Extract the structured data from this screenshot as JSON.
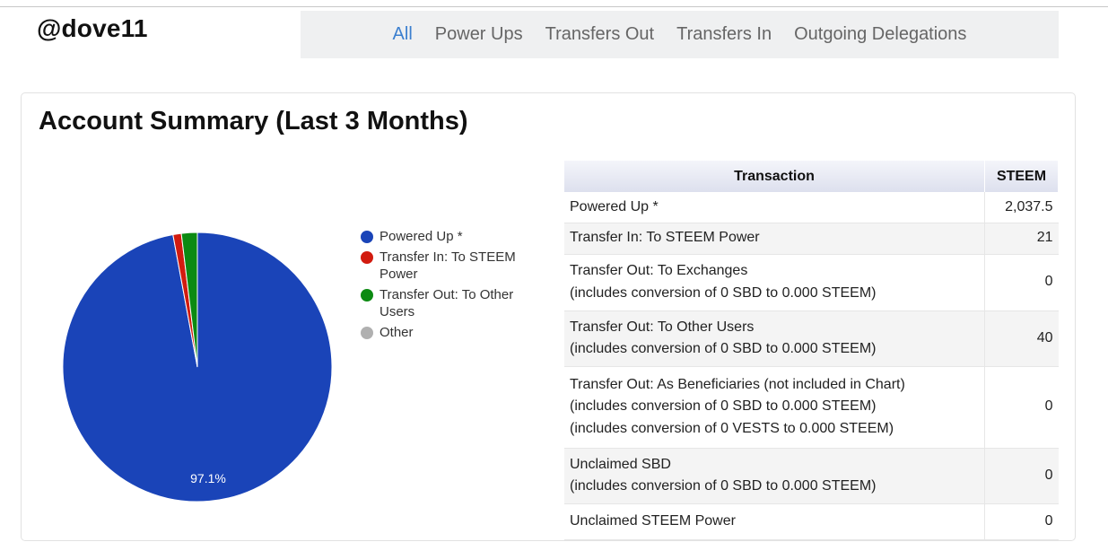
{
  "username": "@dove11",
  "nav": {
    "tabs": [
      {
        "label": "All",
        "active": true
      },
      {
        "label": "Power Ups",
        "active": false
      },
      {
        "label": "Transfers Out",
        "active": false
      },
      {
        "label": "Transfers In",
        "active": false
      },
      {
        "label": "Outgoing Delegations",
        "active": false
      }
    ]
  },
  "summary": {
    "title": "Account Summary (Last 3 Months)"
  },
  "chart_data": {
    "type": "pie",
    "title": "",
    "legend_position": "right",
    "slices": [
      {
        "label": "Powered Up *",
        "value": 2037.5,
        "color": "#1a44b8"
      },
      {
        "label": "Transfer In: To STEEM Power",
        "value": 21,
        "color": "#d21b0f"
      },
      {
        "label": "Transfer Out: To Other Users",
        "value": 40,
        "color": "#0c8a12"
      },
      {
        "label": "Other",
        "value": 0,
        "color": "#b0b0b0"
      }
    ],
    "slice_labels": [
      "97.1%"
    ]
  },
  "table": {
    "headers": [
      "Transaction",
      "STEEM"
    ],
    "rows": [
      {
        "lines": [
          "Powered Up *"
        ],
        "value": "2,037.5"
      },
      {
        "lines": [
          "Transfer In: To STEEM Power"
        ],
        "value": "21"
      },
      {
        "lines": [
          "Transfer Out: To Exchanges",
          "(includes conversion of 0 SBD to 0.000 STEEM)"
        ],
        "value": "0"
      },
      {
        "lines": [
          "Transfer Out: To Other Users",
          "(includes conversion of 0 SBD to 0.000 STEEM)"
        ],
        "value": "40"
      },
      {
        "lines": [
          "Transfer Out: As Beneficiaries (not included in Chart)",
          "(includes conversion of 0 SBD to 0.000 STEEM)",
          "(includes conversion of 0 VESTS to 0.000 STEEM)"
        ],
        "value": "0"
      },
      {
        "lines": [
          "Unclaimed SBD",
          "(includes conversion of 0 SBD to 0.000 STEEM)"
        ],
        "value": "0"
      },
      {
        "lines": [
          "Unclaimed STEEM Power"
        ],
        "value": "0"
      }
    ]
  }
}
